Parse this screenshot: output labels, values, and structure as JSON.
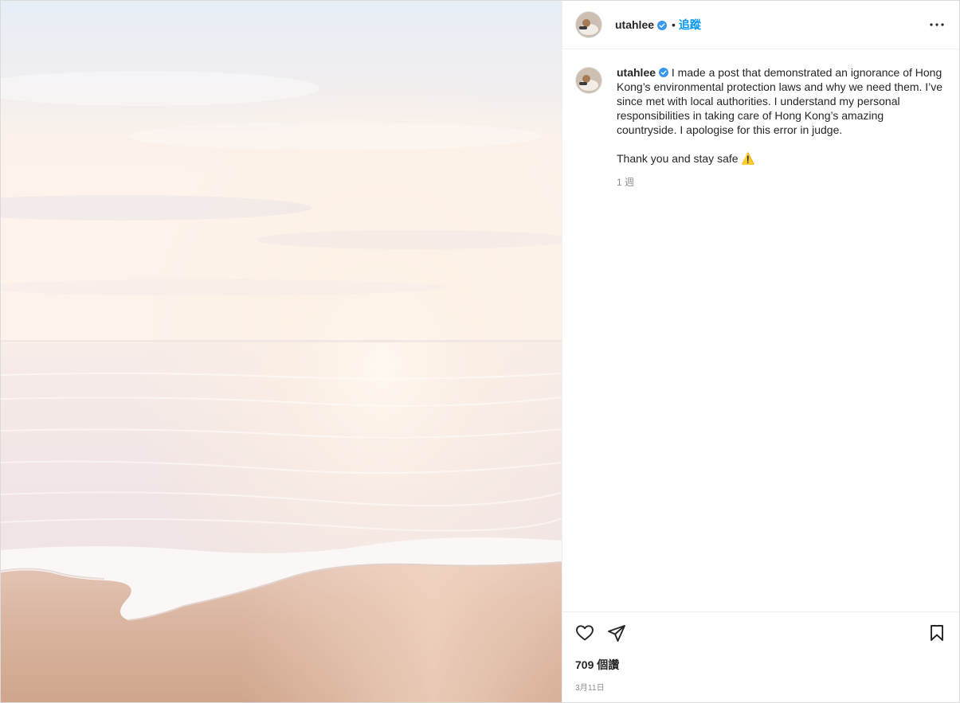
{
  "post": {
    "username": "utahlee",
    "follow_label": "追蹤",
    "separator": "•",
    "caption_text": "I made a post that demonstrated an ignorance of Hong Kong’s environmental protection laws and why we need them. I’ve since met with local authorities. I understand my personal responsibilities in taking care of Hong Kong’s amazing countryside. I apologise for this error in judge.",
    "caption_line2": "Thank you and stay safe ⚠️",
    "time_ago": "1 週",
    "likes": "709 個讚",
    "date": "3月11日"
  },
  "icons": {
    "verified": "verified-badge-icon",
    "more": "more-options-icon",
    "like": "heart-icon",
    "share": "paper-plane-icon",
    "save": "bookmark-icon"
  },
  "colors": {
    "accent": "#0095f6",
    "text": "#262626",
    "muted": "#8e8e8e"
  }
}
